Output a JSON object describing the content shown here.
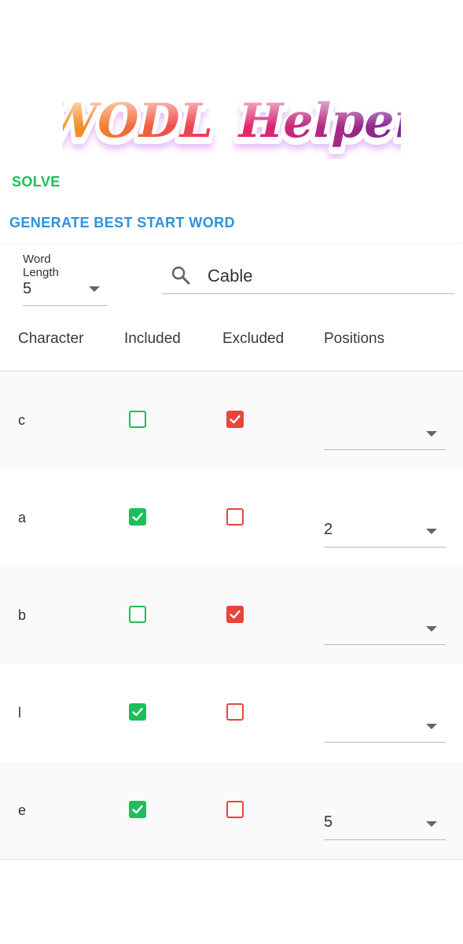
{
  "app": {
    "title_part1": "WODL",
    "title_part2": "Helper"
  },
  "actions": {
    "solve_label": "SOLVE",
    "generate_label": "GENERATE BEST START WORD"
  },
  "colors": {
    "included": "#1DBF5A",
    "excluded": "#E8453C",
    "generate": "#2B93DB"
  },
  "word_length": {
    "label": "Word Length",
    "value": "5"
  },
  "search": {
    "icon": "search-icon",
    "value": "Cable"
  },
  "table": {
    "headers": [
      "Character",
      "Included",
      "Excluded",
      "Positions"
    ],
    "rows": [
      {
        "character": "c",
        "included": false,
        "excluded": true,
        "position": ""
      },
      {
        "character": "a",
        "included": true,
        "excluded": false,
        "position": "2"
      },
      {
        "character": "b",
        "included": false,
        "excluded": true,
        "position": ""
      },
      {
        "character": "l",
        "included": true,
        "excluded": false,
        "position": ""
      },
      {
        "character": "e",
        "included": true,
        "excluded": false,
        "position": "5"
      }
    ]
  }
}
